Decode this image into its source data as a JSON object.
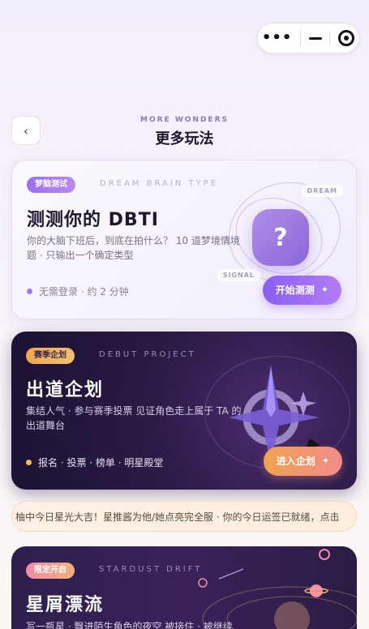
{
  "capsule": {
    "more_icon": "more-dots-icon",
    "minimize_icon": "minus-icon",
    "close_icon": "target-icon"
  },
  "header": {
    "back_icon": "‹",
    "subtitle": "MORE WONDERS",
    "title": "更多玩法"
  },
  "cards": [
    {
      "badge": "梦脑测试",
      "ghost": "DREAM BRAIN TYPE",
      "title": "测测你的 DBTI",
      "desc": "你的大脑下班后，到底在拍什么？ 10 道梦境情境题 · 只输出一个确定类型",
      "meta": "无需登录 · 约 2 分钟",
      "cta": "开始测测",
      "tag_top": "DREAM",
      "tag_bottom": "SIGNAL",
      "symbol": "?"
    },
    {
      "badge": "赛季企划",
      "ghost": "DEBUT PROJECT",
      "title": "出道企划",
      "desc": "集结人气 · 参与赛季投票 见证角色走上属于 TA 的出道舞台",
      "meta": "报名 · 投票 · 榜单 · 明星殿堂",
      "cta": "进入企划"
    },
    {
      "badge": "限定开启",
      "ghost": "STARDUST DRIFT",
      "title": "星屑漂流",
      "desc": "写一瓶星 · 飘进陌生角色的夜空 被接住 · 被继续"
    }
  ],
  "ticker": "柚中今日星光大吉！星推酱为他/她点亮完全服 · 你的今日运签已就绪，点击",
  "colors": {
    "accent_purple": "#8a5ef0",
    "accent_orange": "#f0a350",
    "dark_card": "#2a1a45"
  }
}
